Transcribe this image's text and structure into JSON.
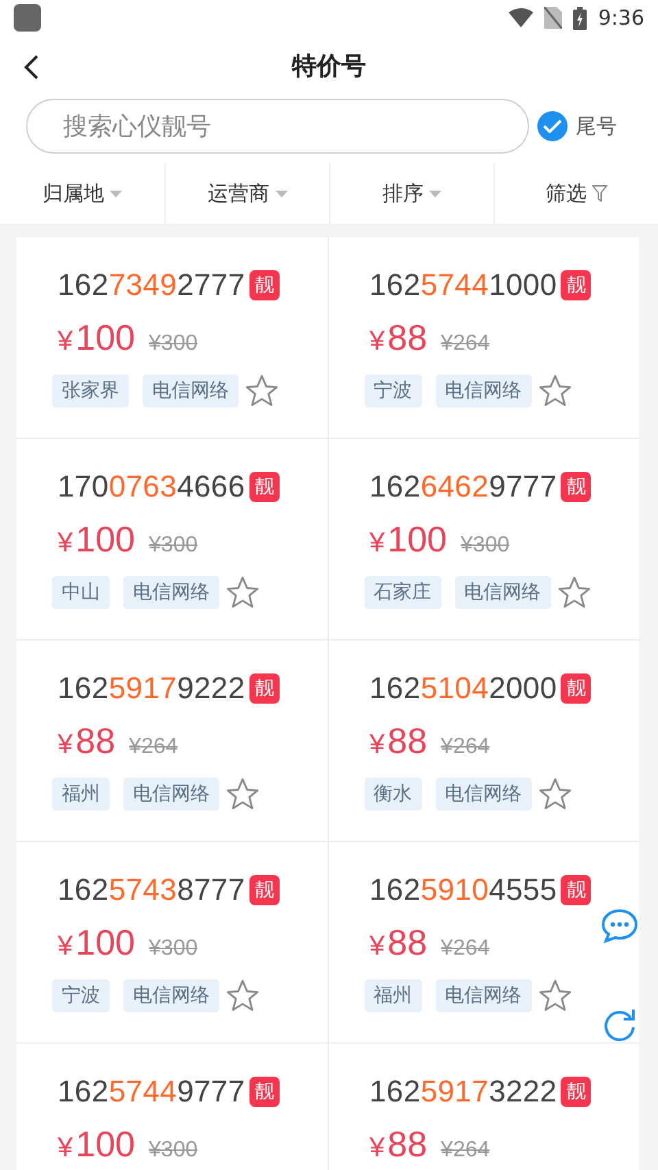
{
  "status_bar": {
    "time": "9:36"
  },
  "header": {
    "title": "特价号"
  },
  "search": {
    "placeholder": "搜索心仪靓号",
    "tail_option": {
      "label": "尾号",
      "checked": true
    }
  },
  "filters": [
    {
      "label": "归属地",
      "kind": "dropdown"
    },
    {
      "label": "运营商",
      "kind": "dropdown"
    },
    {
      "label": "排序",
      "kind": "dropdown"
    },
    {
      "label": "筛选",
      "kind": "funnel"
    }
  ],
  "numbers": [
    {
      "prefix": "162",
      "highlight": "7349",
      "suffix": "2777",
      "badge": "靓",
      "currency": "¥",
      "price": "100",
      "original_price": "¥300",
      "tags": [
        "张家界",
        "电信网络"
      ],
      "favorited": false
    },
    {
      "prefix": "162",
      "highlight": "5744",
      "suffix": "1000",
      "badge": "靓",
      "currency": "¥",
      "price": "88",
      "original_price": "¥264",
      "tags": [
        "宁波",
        "电信网络"
      ],
      "favorited": false
    },
    {
      "prefix": "170",
      "highlight": "0763",
      "suffix": "4666",
      "badge": "靓",
      "currency": "¥",
      "price": "100",
      "original_price": "¥300",
      "tags": [
        "中山",
        "电信网络"
      ],
      "favorited": false
    },
    {
      "prefix": "162",
      "highlight": "6462",
      "suffix": "9777",
      "badge": "靓",
      "currency": "¥",
      "price": "100",
      "original_price": "¥300",
      "tags": [
        "石家庄",
        "电信网络"
      ],
      "favorited": false
    },
    {
      "prefix": "162",
      "highlight": "5917",
      "suffix": "9222",
      "badge": "靓",
      "currency": "¥",
      "price": "88",
      "original_price": "¥264",
      "tags": [
        "福州",
        "电信网络"
      ],
      "favorited": false
    },
    {
      "prefix": "162",
      "highlight": "5104",
      "suffix": "2000",
      "badge": "靓",
      "currency": "¥",
      "price": "88",
      "original_price": "¥264",
      "tags": [
        "衡水",
        "电信网络"
      ],
      "favorited": false
    },
    {
      "prefix": "162",
      "highlight": "5743",
      "suffix": "8777",
      "badge": "靓",
      "currency": "¥",
      "price": "100",
      "original_price": "¥300",
      "tags": [
        "宁波",
        "电信网络"
      ],
      "favorited": false
    },
    {
      "prefix": "162",
      "highlight": "5910",
      "suffix": "4555",
      "badge": "靓",
      "currency": "¥",
      "price": "88",
      "original_price": "¥264",
      "tags": [
        "福州",
        "电信网络"
      ],
      "favorited": false
    },
    {
      "prefix": "162",
      "highlight": "5744",
      "suffix": "9777",
      "badge": "靓",
      "currency": "¥",
      "price": "100",
      "original_price": "¥300"
    },
    {
      "prefix": "162",
      "highlight": "5917",
      "suffix": "3222",
      "badge": "靓",
      "currency": "¥",
      "price": "88",
      "original_price": "¥264"
    }
  ]
}
